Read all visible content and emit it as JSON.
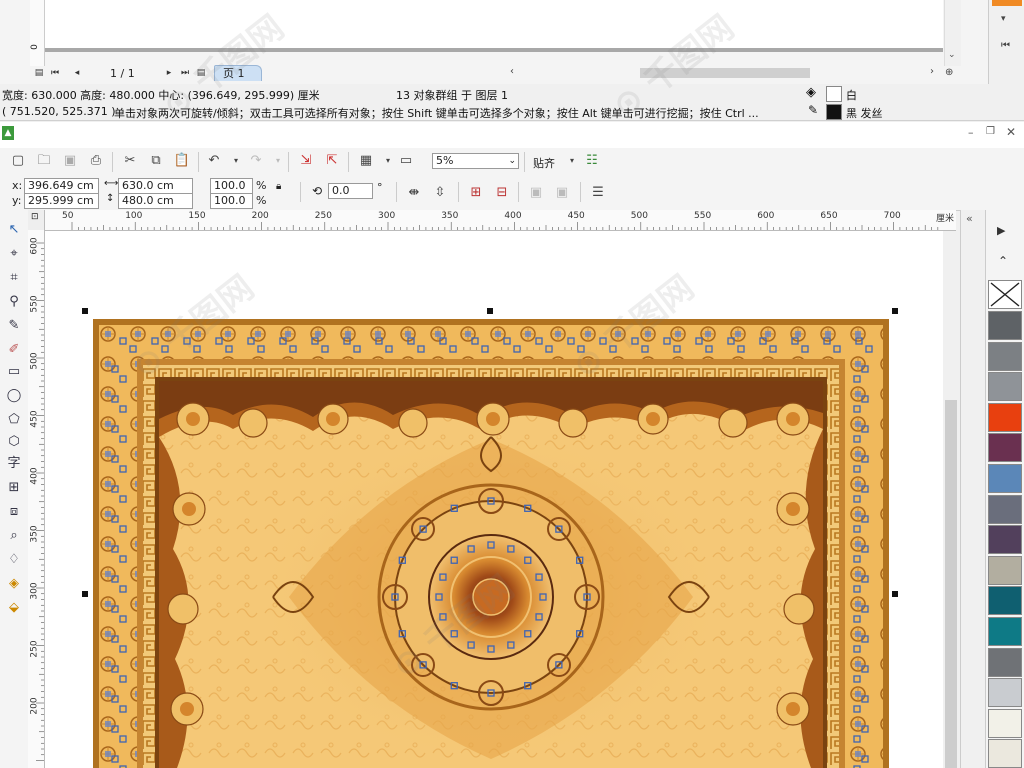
{
  "top_window": {
    "page_counter": "1 / 1",
    "page_tab": "页 1",
    "vruler_label": "0"
  },
  "status": {
    "dimensions": "宽度: 630.000  高度: 480.000  中心: (396.649, 295.999)  厘米",
    "selection": "13 对象群组 于 图层 1",
    "coords": "( 751.520, 525.371 )",
    "hint": "单击对象两次可旋转/倾斜；双击工具可选择所有对象；按住 Shift 键单击可选择多个对象；按住 Alt 键单击可进行挖掘；按住 Ctrl ...",
    "fill_label": "白",
    "outline_label": "黑 发丝",
    "fill_color": "#ffffff",
    "outline_color": "#111111"
  },
  "toolbar": {
    "zoom_value": "5%",
    "snap_label": "贴齐"
  },
  "properties": {
    "x_label": "x:",
    "y_label": "y:",
    "x_value": "396.649 cm",
    "y_value": "295.999 cm",
    "width_value": "630.0 cm",
    "height_value": "480.0 cm",
    "scale_x": "100.0",
    "scale_y": "100.0",
    "percent": "%",
    "rotation": "0.0",
    "degree": "°"
  },
  "hruler": {
    "labels": [
      "50",
      "100",
      "150",
      "200",
      "250",
      "300",
      "350",
      "400",
      "450",
      "500",
      "550",
      "600",
      "650",
      "700"
    ],
    "unit": "厘米"
  },
  "vruler": {
    "labels": [
      "600",
      "550",
      "500",
      "450",
      "400",
      "350",
      "300",
      "250",
      "200"
    ]
  },
  "toolbox": {
    "text_tool": "字"
  },
  "palette": {
    "colors": [
      "#5e6266",
      "#7c8084",
      "#8f9398",
      "#e8400f",
      "#6a3050",
      "#5b87b8",
      "#6a6e7c",
      "#52405c",
      "#b2aea0",
      "#0f5f70",
      "#0e7a86",
      "#6f7276",
      "#c9ccd0",
      "#f2f1e8",
      "#ebe8de"
    ]
  },
  "colors": {
    "accent_orange": "#f08a24",
    "carpet_gold": "#e8b45a",
    "carpet_brown": "#b07220",
    "carpet_dark": "#7a4310"
  }
}
